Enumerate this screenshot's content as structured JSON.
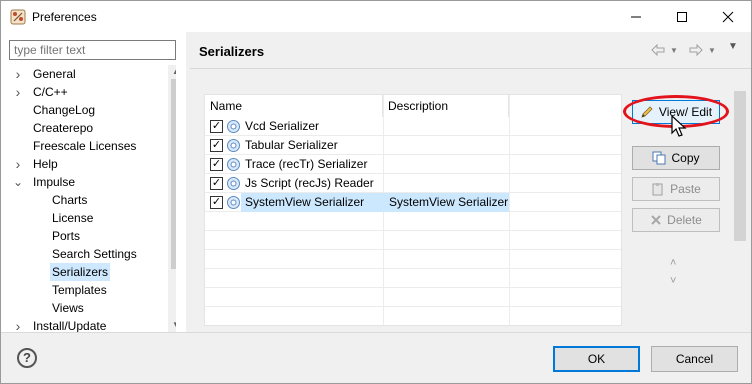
{
  "window": {
    "title": "Preferences",
    "icon": "eclipse-app-icon"
  },
  "filter": {
    "placeholder": "type filter text"
  },
  "tree": {
    "items": [
      {
        "label": "General",
        "level": 0,
        "arrow": "collapsed"
      },
      {
        "label": "C/C++",
        "level": 0,
        "arrow": "collapsed"
      },
      {
        "label": "ChangeLog",
        "level": 0,
        "arrow": "none"
      },
      {
        "label": "Createrepo",
        "level": 0,
        "arrow": "none"
      },
      {
        "label": "Freescale Licenses",
        "level": 0,
        "arrow": "none"
      },
      {
        "label": "Help",
        "level": 0,
        "arrow": "collapsed"
      },
      {
        "label": "Impulse",
        "level": 0,
        "arrow": "expanded"
      },
      {
        "label": "Charts",
        "level": 1,
        "arrow": "none"
      },
      {
        "label": "License",
        "level": 1,
        "arrow": "none"
      },
      {
        "label": "Ports",
        "level": 1,
        "arrow": "none"
      },
      {
        "label": "Search Settings",
        "level": 1,
        "arrow": "none"
      },
      {
        "label": "Serializers",
        "level": 1,
        "arrow": "none",
        "selected": true
      },
      {
        "label": "Templates",
        "level": 1,
        "arrow": "none"
      },
      {
        "label": "Views",
        "level": 1,
        "arrow": "none"
      },
      {
        "label": "Install/Update",
        "level": 0,
        "arrow": "collapsed"
      }
    ]
  },
  "page": {
    "title": "Serializers"
  },
  "table": {
    "columns": [
      "Name",
      "Description"
    ],
    "rows": [
      {
        "name": "Vcd Serializer",
        "description": "",
        "checked": true,
        "selected": false
      },
      {
        "name": "Tabular Serializer",
        "description": "",
        "checked": true,
        "selected": false
      },
      {
        "name": "Trace (recTr) Serializer",
        "description": "",
        "checked": true,
        "selected": false
      },
      {
        "name": "Js Script (recJs) Reader",
        "description": "",
        "checked": true,
        "selected": false
      },
      {
        "name": "SystemView Serializer",
        "description": "SystemView Serializer",
        "checked": true,
        "selected": true
      }
    ]
  },
  "buttons": {
    "edit": "View/ Edit",
    "copy": "Copy",
    "paste": "Paste",
    "delete": "Delete"
  },
  "dialog": {
    "ok": "OK",
    "cancel": "Cancel",
    "help_symbol": "?"
  },
  "colors": {
    "accent": "#0078d7",
    "highlight_ring": "#e3131c",
    "selection": "#cce8ff"
  }
}
